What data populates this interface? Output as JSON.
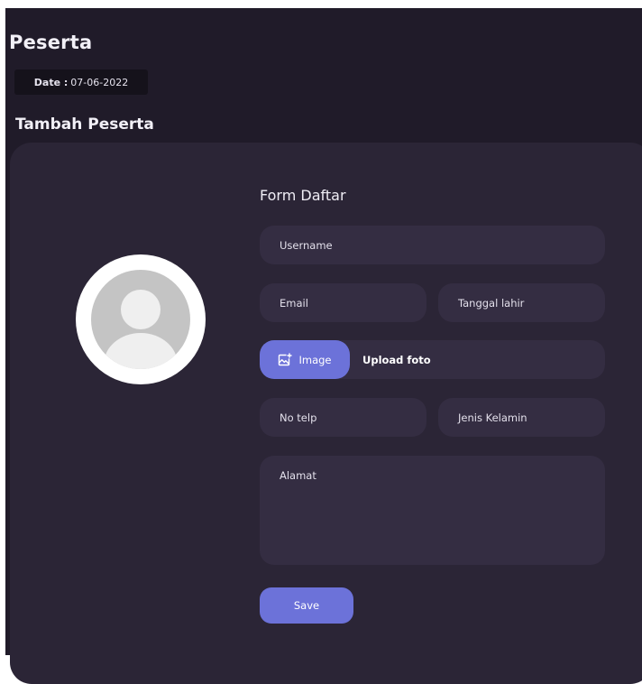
{
  "header": {
    "title": "Peserta",
    "date_label": "Date :",
    "date_value": "07-06-2022",
    "section_title": "Tambah Peserta"
  },
  "form": {
    "title": "Form Daftar",
    "username_placeholder": "Username",
    "email_placeholder": "Email",
    "tanggal_lahir_placeholder": "Tanggal lahir",
    "image_button_label": "Image",
    "image_button_icon": "image-plus-icon",
    "upload_label": "Upload foto",
    "no_telp_placeholder": "No telp",
    "jenis_kelamin_placeholder": "Jenis Kelamin",
    "alamat_placeholder": "Alamat",
    "save_label": "Save"
  },
  "avatar": {
    "icon": "user-placeholder-icon"
  },
  "colors": {
    "background": "#201b29",
    "card": "#2b2536",
    "field": "#342d42",
    "accent": "#6c72d9",
    "date_chip": "#15121b"
  }
}
